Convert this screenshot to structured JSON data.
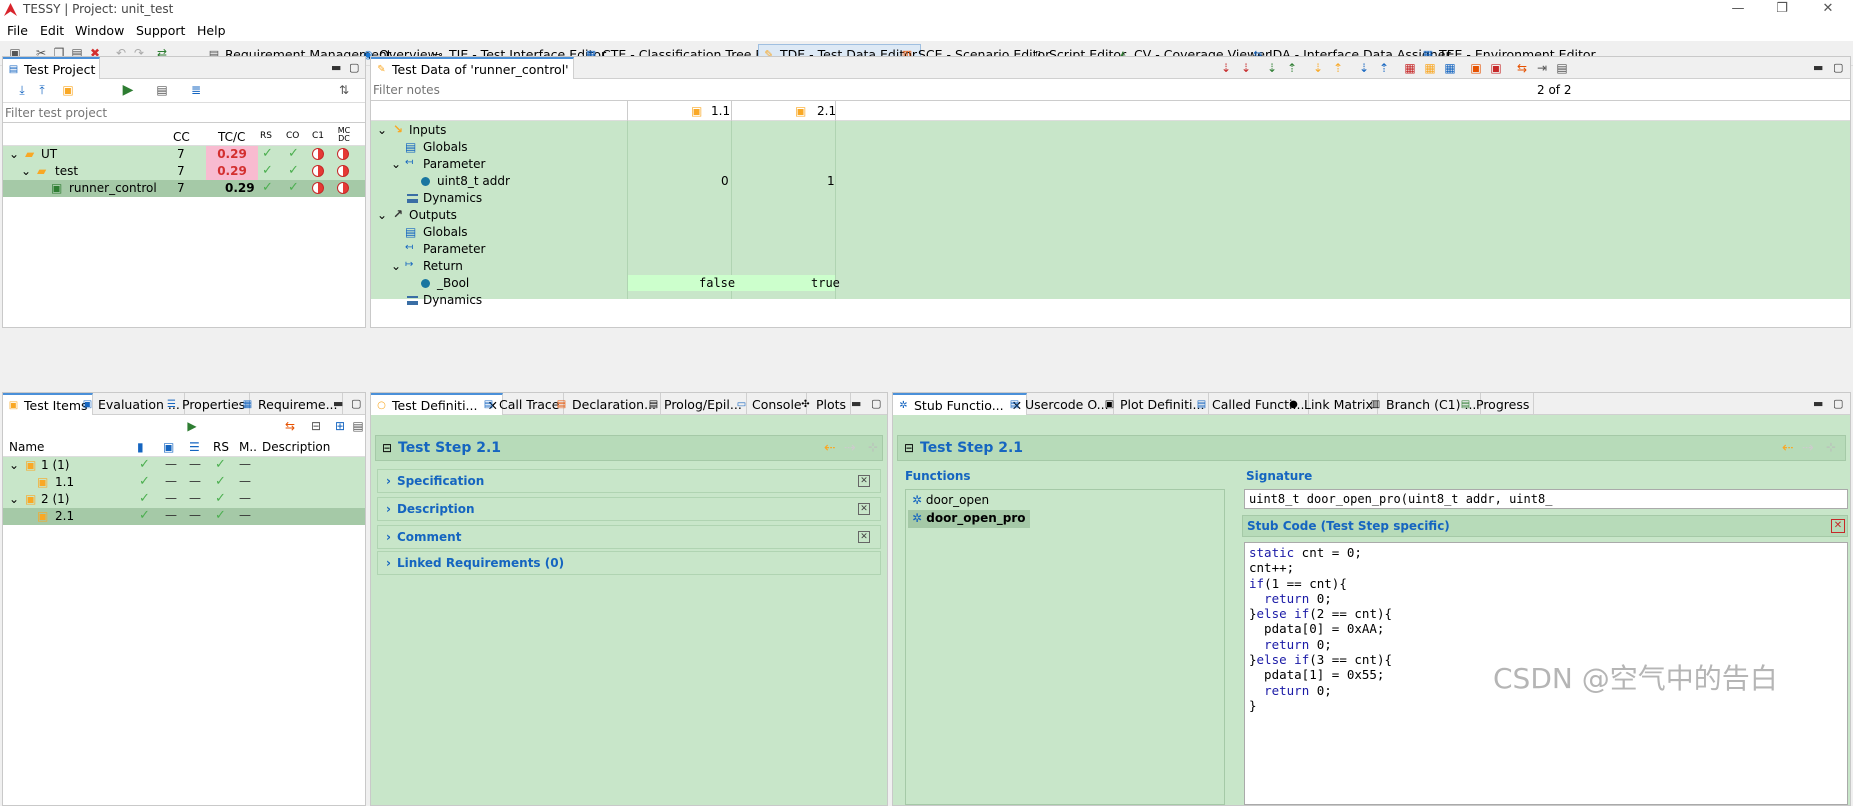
{
  "app": {
    "title": "TESSY | Project: unit_test"
  },
  "menu": [
    "File",
    "Edit",
    "Window",
    "Support",
    "Help"
  ],
  "perspectives": [
    {
      "label": "Requirement Management",
      "icon": "requirement-icon"
    },
    {
      "label": "Overview",
      "icon": "overview-icon"
    },
    {
      "label": "TIE - Test Interface Editor",
      "icon": "interface-icon"
    },
    {
      "label": "CTE - Classification Tree Editor",
      "icon": "tree-editor-icon"
    },
    {
      "label": "TDE - Test Data Editor",
      "icon": "data-editor-icon",
      "active": true
    },
    {
      "label": "SCE - Scenario Editor",
      "icon": "scenario-icon"
    },
    {
      "label": "Script Editor",
      "icon": "script-icon"
    },
    {
      "label": "CV - Coverage Viewer",
      "icon": "coverage-icon"
    },
    {
      "label": "IDA - Interface Data Assigner",
      "icon": "ida-icon"
    },
    {
      "label": "TEE - Environment Editor",
      "icon": "env-icon"
    }
  ],
  "test_project": {
    "tab": "Test Project",
    "filter_placeholder": "Filter test project",
    "columns": [
      "CC",
      "TC/C",
      "RS",
      "CO",
      "C1",
      "MC DC"
    ],
    "rows": [
      {
        "name": "UT",
        "cc": "7",
        "tcc": "0.29"
      },
      {
        "name": "test",
        "cc": "7",
        "tcc": "0.29"
      },
      {
        "name": "runner_control",
        "cc": "7",
        "tcc": "0.29"
      }
    ]
  },
  "test_data": {
    "tab": "Test Data of 'runner_control'",
    "filter_placeholder": "Filter notes",
    "page_info": "2 of 2",
    "columns": [
      "1.1",
      "2.1"
    ],
    "tree": {
      "inputs": "Inputs",
      "globals": "Globals",
      "parameter": "Parameter",
      "param_name": "uint8_t addr",
      "param_values": [
        "0",
        "1"
      ],
      "dynamics": "Dynamics",
      "outputs": "Outputs",
      "out_globals": "Globals",
      "out_parameter": "Parameter",
      "return": "Return",
      "ret_name": "_Bool",
      "ret_values": [
        "false",
        "true"
      ],
      "out_dynamics": "Dynamics"
    }
  },
  "test_items": {
    "tabs": [
      "Test Items",
      "Evaluation ...",
      "Properties",
      "Requireme..."
    ],
    "columns": [
      "Name",
      "RS",
      "M..",
      "Description"
    ],
    "rows": [
      {
        "name": "1 (1)"
      },
      {
        "name": "1.1"
      },
      {
        "name": "2 (1)"
      },
      {
        "name": "2.1"
      }
    ]
  },
  "test_def": {
    "tabs": [
      "Test Definiti...",
      "Call Trace",
      "Declaration...",
      "Prolog/Epil...",
      "Console",
      "Plots"
    ],
    "title": "Test Step 2.1",
    "sections": [
      "Specification",
      "Description",
      "Comment",
      "Linked Requirements (0)"
    ]
  },
  "stub": {
    "tabs": [
      "Stub Functio...",
      "Usercode O...",
      "Plot Definiti...",
      "Called Functi...",
      "Link Matrix",
      "Branch (C1) ...",
      "Progress"
    ],
    "title": "Test Step 2.1",
    "functions_label": "Functions",
    "functions": [
      "door_open",
      "door_open_pro"
    ],
    "signature_label": "Signature",
    "signature": "uint8_t door_open_pro(uint8_t addr, uint8_",
    "code_label": "Stub Code (Test Step specific)",
    "code": [
      "static cnt = 0;",
      "",
      "cnt++;",
      "",
      "if(1 == cnt){",
      "  return 0;",
      "}else if(2 == cnt){",
      "  pdata[0] = 0xAA;",
      "  return 0;",
      "}else if(3 == cnt){",
      "  pdata[1] = 0x55;",
      "  return 0;",
      "}"
    ]
  },
  "watermark": "CSDN @空气中的告白"
}
